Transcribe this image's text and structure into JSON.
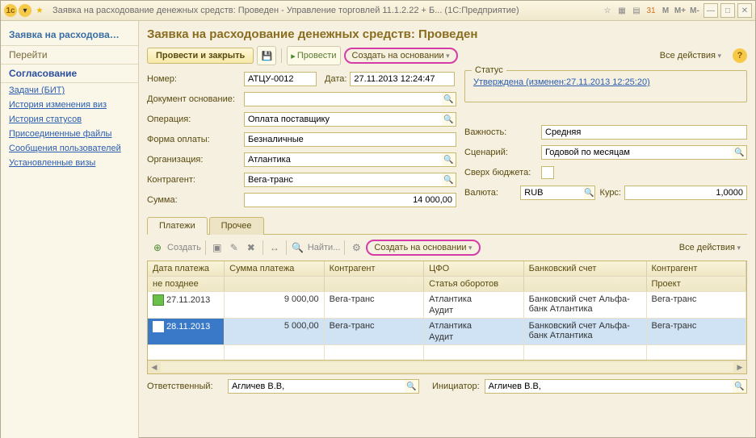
{
  "window": {
    "title": "Заявка на расходование денежных средств: Проведен - Управление торговлей 11.1.2.22 + Б...  (1С:Предприятие)"
  },
  "sidebar": {
    "header": "Заявка на расходова…",
    "nav": "Перейти",
    "active": "Согласование",
    "links": [
      "Задачи (БИТ)",
      "История изменения виз",
      "История статусов",
      "Присоединенные файлы",
      "Сообщения пользователей",
      "Установленные визы"
    ]
  },
  "form": {
    "title": "Заявка на расходование денежных средств: Проведен",
    "toolbar": {
      "main": "Провести и закрыть",
      "post": "Провести",
      "create_based": "Создать на основании",
      "all_actions": "Все действия"
    },
    "labels": {
      "number": "Номер:",
      "date": "Дата:",
      "basis": "Документ основание:",
      "operation": "Операция:",
      "payform": "Форма оплаты:",
      "org": "Организация:",
      "counter": "Контрагент:",
      "sum": "Сумма:",
      "status_legend": "Статус",
      "importance": "Важность:",
      "scenario": "Сценарий:",
      "over_budget": "Сверх бюджета:",
      "currency": "Валюта:",
      "rate": "Курс:",
      "responsible": "Ответственный:",
      "initiator": "Инициатор:"
    },
    "values": {
      "number": "АТЦУ-0012",
      "date": "27.11.2013 12:24:47",
      "basis": "",
      "operation": "Оплата поставщику",
      "payform": "Безналичные",
      "org": "Атлантика",
      "counter": "Вега-транс",
      "sum": "14 000,00",
      "status": "Утверждена (изменен:27.11.2013 12:25:20)",
      "importance": "Средняя",
      "scenario": "Годовой по месяцам",
      "currency": "RUB",
      "rate": "1,0000",
      "responsible": "Агличев В.В,",
      "initiator": "Агличев В.В,"
    }
  },
  "tabs": {
    "payments": "Платежи",
    "other": "Прочее"
  },
  "subtoolbar": {
    "create": "Создать",
    "find": "Найти...",
    "create_based": "Создать на основании",
    "all_actions": "Все действия"
  },
  "table": {
    "headers": {
      "c1": "Дата платежа",
      "c1s": "не позднее",
      "c2": "Сумма платежа",
      "c3": "Контрагент",
      "c4": "ЦФО",
      "c4s": "Статья оборотов",
      "c5": "Банковский счет",
      "c6": "Контрагент",
      "c6s": "Проект"
    },
    "rows": [
      {
        "date": "27.11.2013",
        "sum": "9 000,00",
        "counter": "Вега-транс",
        "cfo": "Атлантика",
        "cfo2": "Аудит",
        "bank": "Банковский счет Альфа-банк Атлантика",
        "proj": "Вега-транс"
      },
      {
        "date": "28.11.2013",
        "sum": "5 000,00",
        "counter": "Вега-транс",
        "cfo": "Атлантика",
        "cfo2": "Аудит",
        "bank": "Банковский счет Альфа-банк Атлантика",
        "proj": "Вега-транс"
      }
    ]
  }
}
